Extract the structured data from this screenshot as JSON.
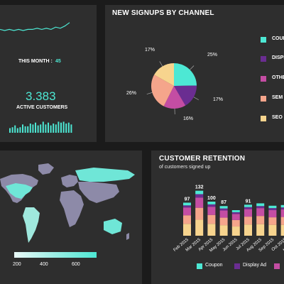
{
  "colors": {
    "background": "#1b1b1b",
    "panel": "#2e2e2e",
    "accent": "#4de8d4",
    "coupon": "#4de8d4",
    "display_ad": "#6a2d91",
    "other": "#c44da3",
    "sem": "#f5a58b",
    "seo": "#f7d48e",
    "map_land": "#8d8aa8"
  },
  "top_left": {
    "this_month_label": "THIS MONTH :",
    "this_month_value": "45",
    "active_value": "3.383",
    "active_label": "ACTIVE CUSTOMERS",
    "sparkline": [
      6,
      5,
      6,
      5,
      6,
      5,
      6,
      6,
      7,
      6,
      7,
      6,
      8,
      7,
      9,
      12
    ],
    "bars": [
      5,
      6,
      8,
      5,
      6,
      9,
      7,
      7,
      10,
      9,
      11,
      8,
      9,
      12,
      9,
      11,
      8,
      10,
      9,
      12,
      11,
      12,
      10,
      11,
      9
    ]
  },
  "signups": {
    "title": "NEW SIGNUPS BY CHANNEL",
    "chart_data": {
      "type": "pie",
      "title": "NEW SIGNUPS BY CHANNEL",
      "slices": [
        {
          "name": "COUPON",
          "value": 25,
          "label": "25%",
          "color": "#4de8d4"
        },
        {
          "name": "DISPLAY",
          "value": 17,
          "label": "17%",
          "color": "#6a2d91"
        },
        {
          "name": "OTHER",
          "value": 16,
          "label": "16%",
          "color": "#c44da3"
        },
        {
          "name": "SEM",
          "value": 26,
          "label": "26%",
          "color": "#f5a58b"
        },
        {
          "name": "SEO",
          "value": 17,
          "label": "17%",
          "color": "#f7d48e"
        }
      ]
    },
    "legend": [
      "COUPON",
      "DISPLAY",
      "OTHER",
      "SEM",
      "SEO"
    ]
  },
  "map": {
    "scale_labels": [
      "200",
      "400",
      "600"
    ]
  },
  "retention": {
    "title": "CUSTOMER RETENTION",
    "subtitle": "of customers signed up",
    "chart_data": {
      "type": "bar",
      "categories": [
        "Feb 2015",
        "Mar 2015",
        "Apr 2015",
        "May 2015",
        "Jun 2015",
        "Jul 2015",
        "Aug 2015",
        "Sep 2015",
        "Oct 2015",
        "Nov 2015"
      ],
      "totals": [
        97,
        132,
        100,
        87,
        75,
        91,
        95,
        88,
        90,
        93
      ],
      "total_labels": [
        "97",
        "132",
        "100",
        "87",
        "",
        "91",
        "",
        "",
        "",
        ""
      ],
      "series": [
        {
          "name": "Coupon",
          "color": "#4de8d4",
          "values": [
            8,
            10,
            8,
            7,
            6,
            7,
            8,
            7,
            7,
            8
          ]
        },
        {
          "name": "Display Ad",
          "color": "#6a2d91",
          "values": [
            6,
            10,
            7,
            6,
            5,
            6,
            6,
            6,
            6,
            6
          ]
        },
        {
          "name": "Other",
          "color": "#c44da3",
          "values": [
            23,
            30,
            24,
            21,
            18,
            22,
            23,
            21,
            22,
            22
          ]
        },
        {
          "name": "SEM",
          "color": "#f5a58b",
          "values": [
            25,
            35,
            26,
            22,
            19,
            23,
            24,
            22,
            23,
            24
          ]
        },
        {
          "name": "SEO",
          "color": "#f7d48e",
          "values": [
            35,
            47,
            35,
            31,
            27,
            33,
            34,
            32,
            32,
            33
          ]
        }
      ],
      "ylim": [
        0,
        140
      ]
    },
    "legend": [
      "Coupon",
      "Display Ad"
    ]
  }
}
